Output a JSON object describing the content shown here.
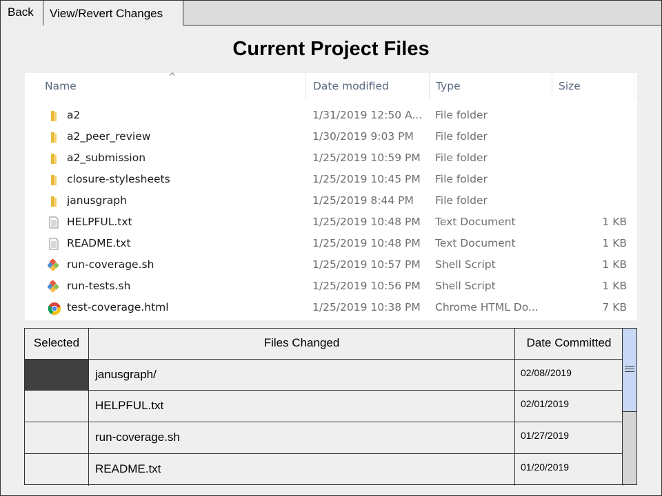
{
  "toolbar": {
    "back_label": "Back",
    "view_revert_label": "View/Revert Changes"
  },
  "page_title": "Current Project Files",
  "explorer": {
    "columns": [
      "Name",
      "Date modified",
      "Type",
      "Size"
    ],
    "sort_indicator": "^",
    "rows": [
      {
        "name": "a2",
        "date": "1/31/2019 12:50 A...",
        "type": "File folder",
        "size": "",
        "icon": "folder-icon"
      },
      {
        "name": "a2_peer_review",
        "date": "1/30/2019 9:03 PM",
        "type": "File folder",
        "size": "",
        "icon": "folder-icon"
      },
      {
        "name": "a2_submission",
        "date": "1/25/2019 10:59 PM",
        "type": "File folder",
        "size": "",
        "icon": "folder-icon"
      },
      {
        "name": "closure-stylesheets",
        "date": "1/25/2019 10:45 PM",
        "type": "File folder",
        "size": "",
        "icon": "folder-icon"
      },
      {
        "name": "janusgraph",
        "date": "1/25/2019 8:44 PM",
        "type": "File folder",
        "size": "",
        "icon": "folder-icon"
      },
      {
        "name": "HELPFUL.txt",
        "date": "1/25/2019 10:48 PM",
        "type": "Text Document",
        "size": "1 KB",
        "icon": "text-document-icon"
      },
      {
        "name": "README.txt",
        "date": "1/25/2019 10:48 PM",
        "type": "Text Document",
        "size": "1 KB",
        "icon": "text-document-icon"
      },
      {
        "name": "run-coverage.sh",
        "date": "1/25/2019 10:57 PM",
        "type": "Shell Script",
        "size": "1 KB",
        "icon": "git-script-icon"
      },
      {
        "name": "run-tests.sh",
        "date": "1/25/2019 10:56 PM",
        "type": "Shell Script",
        "size": "1 KB",
        "icon": "git-script-icon"
      },
      {
        "name": "test-coverage.html",
        "date": "1/25/2019 10:38 PM",
        "type": "Chrome HTML Do...",
        "size": "7 KB",
        "icon": "chrome-icon"
      }
    ]
  },
  "changes_table": {
    "headers": {
      "selected": "Selected",
      "files": "Files Changed",
      "date": "Date Committed"
    },
    "rows": [
      {
        "file": "janusgraph/",
        "date": "02/08//2019",
        "selected": true
      },
      {
        "file": "HELPFUL.txt",
        "date": "02/01/2019",
        "selected": false
      },
      {
        "file": "run-coverage.sh",
        "date": "01/27/2019",
        "selected": false
      },
      {
        "file": "README.txt",
        "date": "01/20/2019",
        "selected": false
      }
    ]
  },
  "colors": {
    "selected_cell": "#404040",
    "scroll_thumb": "#c8d8f5",
    "folder": "#f2c94c",
    "header_text": "#5a6a80"
  }
}
